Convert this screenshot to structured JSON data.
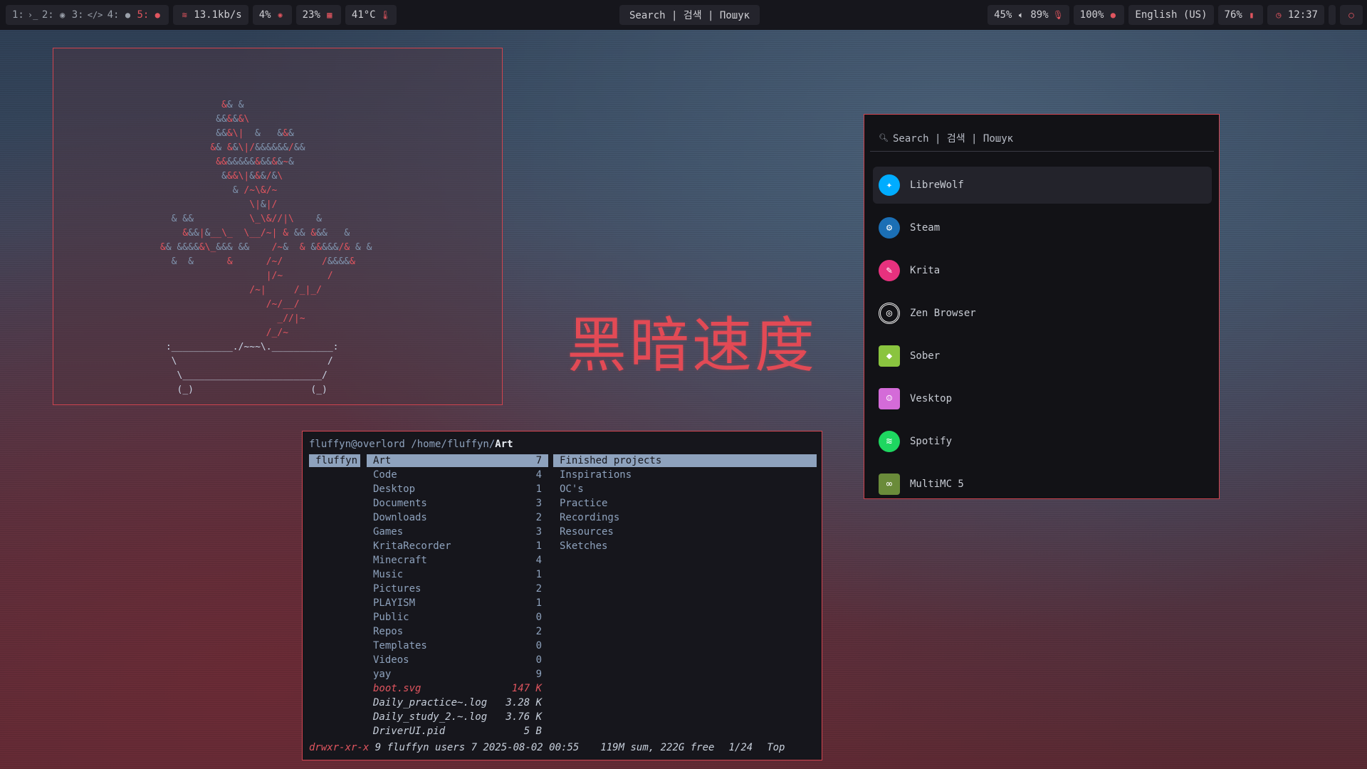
{
  "topbar": {
    "workspaces": [
      {
        "num": "1:",
        "icon": "terminal-icon",
        "glyph": "›_"
      },
      {
        "num": "2:",
        "icon": "chrome-icon",
        "glyph": "◉"
      },
      {
        "num": "3:",
        "icon": "code-icon",
        "glyph": "</>"
      },
      {
        "num": "4:",
        "icon": "circle-icon",
        "glyph": "●"
      },
      {
        "num": "5:",
        "icon": "chat-icon",
        "glyph": "●"
      }
    ],
    "network": "13.1kb/s",
    "cpu": "4%",
    "memory": "23%",
    "temperature": "41°C",
    "search": "Search | 검색 | Пошук",
    "volume": "45%",
    "mic": "89%",
    "brightness": "100%",
    "keyboard_layout": "English (US)",
    "battery": "76%",
    "clock": "12:37"
  },
  "ascii_window": {
    "art_lines": [
      "           && &",
      "          &&&&&\\",
      "          &&&\\|  &   &&&",
      "         && &&\\|/&&&&&&/&&",
      "          &&&&&&&&&&&&~&",
      "           &&&\\|&&&/&\\",
      "             & /~\\&/~",
      "                \\|&|/",
      "  & &&          \\_\\&//|\\    &",
      "    &&&|&__\\_  \\__/~| & && &&&   &",
      "&& &&&&&\\_&&& &&    /~&  & &&&&&/& & &",
      "  &  &      &      /~/       /&&&&&",
      "                   |/~        /",
      "                /~|     /_|_/",
      "                   /~/__/",
      "                     _//|~",
      "                   /_/~",
      " :___________./~~~\\.___________:",
      "  \\                           /",
      "   \\_________________________/",
      "   (_)                     (_)"
    ]
  },
  "title": "黑暗速度",
  "launcher": {
    "search_placeholder": "Search | 검색 | Пошук",
    "apps": [
      {
        "name": "LibreWolf",
        "icon": "librewolf-icon",
        "color": "#00acff",
        "selected": true
      },
      {
        "name": "Steam",
        "icon": "steam-icon",
        "color": "#1b6fb5"
      },
      {
        "name": "Krita",
        "icon": "krita-icon",
        "color": "#e8317e"
      },
      {
        "name": "Zen Browser",
        "icon": "zen-browser-icon",
        "color": "#f0f0f0"
      },
      {
        "name": "Sober",
        "icon": "sober-icon",
        "color": "#8ac43f"
      },
      {
        "name": "Vesktop",
        "icon": "vesktop-icon",
        "color": "#d46bd8"
      },
      {
        "name": "Spotify",
        "icon": "spotify-icon",
        "color": "#1ed760"
      },
      {
        "name": "MultiMC 5",
        "icon": "multimc-icon",
        "color": "#6a8b3a"
      }
    ]
  },
  "file_manager": {
    "path_prefix": "fluffyn@overlord /home/fluffyn/",
    "path_current": "Art",
    "parent": "fluffyn",
    "entries": [
      {
        "name": "Art",
        "count": "7"
      },
      {
        "name": "Code",
        "count": "4"
      },
      {
        "name": "Desktop",
        "count": "1"
      },
      {
        "name": "Documents",
        "count": "3"
      },
      {
        "name": "Downloads",
        "count": "2"
      },
      {
        "name": "Games",
        "count": "3"
      },
      {
        "name": "KritaRecorder",
        "count": "1"
      },
      {
        "name": "Minecraft",
        "count": "4"
      },
      {
        "name": "Music",
        "count": "1"
      },
      {
        "name": "Pictures",
        "count": "2"
      },
      {
        "name": "PLAYISM",
        "count": "1"
      },
      {
        "name": "Public",
        "count": "0"
      },
      {
        "name": "Repos",
        "count": "2"
      },
      {
        "name": "Templates",
        "count": "0"
      },
      {
        "name": "Videos",
        "count": "0"
      },
      {
        "name": "yay",
        "count": "9"
      }
    ],
    "files": [
      {
        "name": "boot.svg",
        "size": "147 K"
      },
      {
        "name": "Daily_practice~.log",
        "size": "3.28 K"
      },
      {
        "name": "Daily_study_2.~.log",
        "size": "3.76 K"
      },
      {
        "name": "DriverUI.pid",
        "size": "5 B"
      }
    ],
    "preview": [
      "Finished projects",
      "Inspirations",
      "OC's",
      "Practice",
      "Recordings",
      "Resources",
      "Sketches"
    ],
    "status": {
      "perms": "drwxr-xr-x",
      "info": " 9 fluffyn users 7 2025-08-02 00:55",
      "summary": "119M sum, 222G free",
      "position": "1/24",
      "scroll": "Top"
    }
  }
}
